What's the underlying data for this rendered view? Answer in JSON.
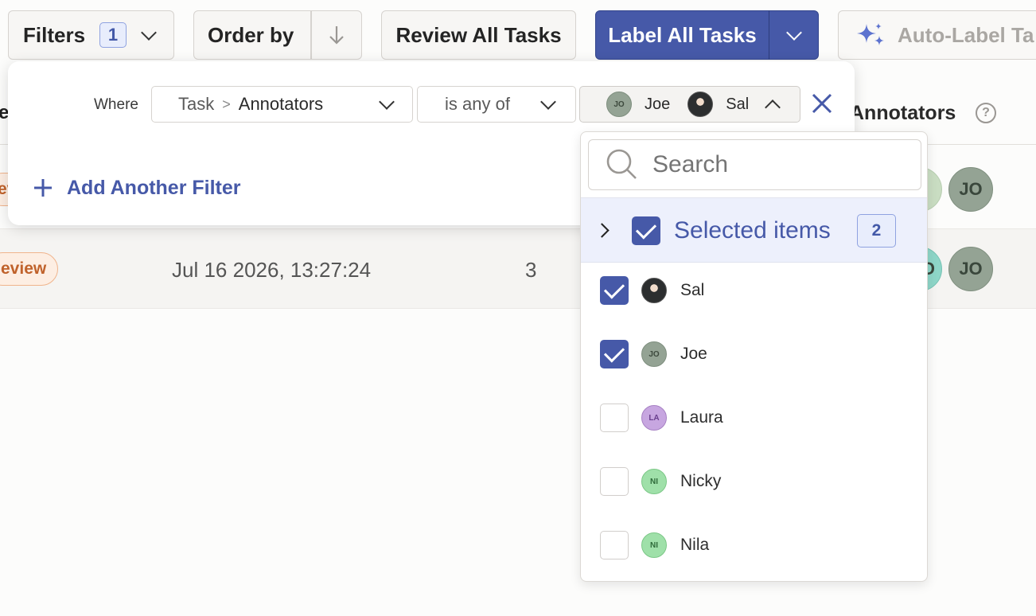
{
  "toolbar": {
    "filters_label": "Filters",
    "filters_count": "1",
    "order_by_label": "Order by",
    "review_all_label": "Review All Tasks",
    "label_all_label": "Label All Tasks",
    "auto_label_label": "Auto-Label Ta"
  },
  "table": {
    "header_partial": "e",
    "header_annotators": "Annotators",
    "rows": [
      {
        "status_partial": "ev",
        "date": "",
        "count": "",
        "avatars": [
          "",
          "JO"
        ]
      },
      {
        "status_partial": "eview",
        "date": "Jul 16 2026, 13:27:24",
        "count": "3",
        "avatars": [
          "O",
          "JO"
        ]
      }
    ]
  },
  "filter": {
    "where_label": "Where",
    "field_prefix": "Task",
    "field_separator": ">",
    "field_name": "Annotators",
    "operator": "is any of",
    "values": [
      {
        "initials": "JO",
        "name": "Joe",
        "type": "gray"
      },
      {
        "initials": "",
        "name": "Sal",
        "type": "photo"
      }
    ],
    "add_filter_label": "Add Another Filter"
  },
  "dropdown": {
    "search_placeholder": "Search",
    "selected_label": "Selected items",
    "selected_count": "2",
    "options": [
      {
        "name": "Sal",
        "initials": "",
        "type": "photo",
        "checked": true
      },
      {
        "name": "Joe",
        "initials": "JO",
        "type": "gray",
        "checked": true
      },
      {
        "name": "Laura",
        "initials": "LA",
        "type": "purple",
        "checked": false
      },
      {
        "name": "Nicky",
        "initials": "NI",
        "type": "green",
        "checked": false
      },
      {
        "name": "Nila",
        "initials": "NI",
        "type": "green",
        "checked": false
      }
    ]
  },
  "colors": {
    "accent": "#4659a8",
    "accent_light": "#edf0fc",
    "review_tag": "#c0622b"
  }
}
